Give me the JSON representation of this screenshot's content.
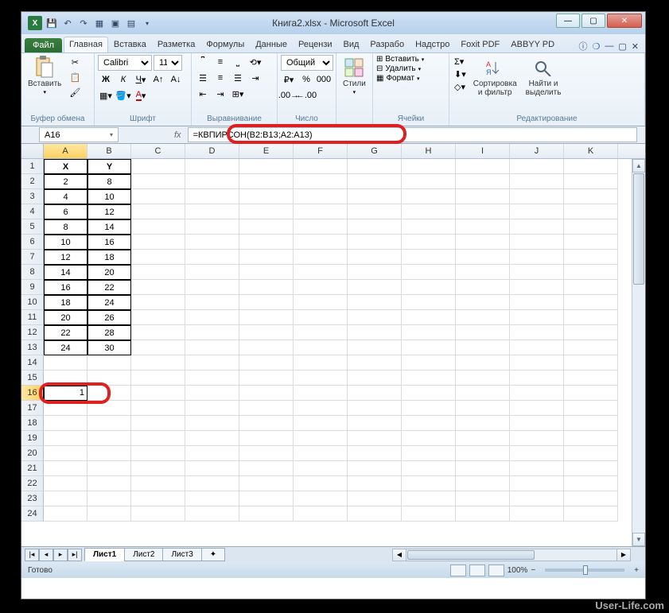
{
  "title": "Книга2.xlsx - Microsoft Excel",
  "file_tab": "Файл",
  "tabs": [
    "Главная",
    "Вставка",
    "Разметка",
    "Формулы",
    "Данные",
    "Рецензи",
    "Вид",
    "Разрабо",
    "Надстро",
    "Foxit PDF",
    "ABBYY PD"
  ],
  "active_tab": 0,
  "groups": {
    "clipboard": {
      "label": "Буфер обмена",
      "paste": "Вставить"
    },
    "font": {
      "label": "Шрифт",
      "name": "Calibri",
      "size": "11"
    },
    "alignment": {
      "label": "Выравнивание"
    },
    "number": {
      "label": "Число",
      "format": "Общий"
    },
    "styles": {
      "label": "",
      "btn": "Стили"
    },
    "cells": {
      "label": "Ячейки",
      "insert": "Вставить",
      "delete": "Удалить",
      "format": "Формат"
    },
    "editing": {
      "label": "Редактирование",
      "sort": "Сортировка\nи фильтр",
      "find": "Найти и\nвыделить"
    }
  },
  "name_box": "A16",
  "formula": "=КВПИРСОН(B2:B13;A2:A13)",
  "columns": [
    "A",
    "B",
    "C",
    "D",
    "E",
    "F",
    "G",
    "H",
    "I",
    "J",
    "K"
  ],
  "col_widths": {
    "default": 68,
    "A": 55,
    "B": 55
  },
  "rows": 24,
  "chart_data": {
    "type": "table",
    "headers": [
      "X",
      "Y"
    ],
    "data": [
      {
        "X": 2,
        "Y": 8
      },
      {
        "X": 4,
        "Y": 10
      },
      {
        "X": 6,
        "Y": 12
      },
      {
        "X": 8,
        "Y": 14
      },
      {
        "X": 10,
        "Y": 16
      },
      {
        "X": 12,
        "Y": 18
      },
      {
        "X": 14,
        "Y": 20
      },
      {
        "X": 16,
        "Y": 22
      },
      {
        "X": 18,
        "Y": 24
      },
      {
        "X": 20,
        "Y": 26
      },
      {
        "X": 22,
        "Y": 28
      },
      {
        "X": 24,
        "Y": 30
      }
    ]
  },
  "selected_cell": {
    "row": 16,
    "col": "A",
    "value": "1"
  },
  "sheets": [
    "Лист1",
    "Лист2",
    "Лист3"
  ],
  "active_sheet": 0,
  "status": "Готово",
  "zoom": "100%",
  "watermark": "User-Life.com"
}
